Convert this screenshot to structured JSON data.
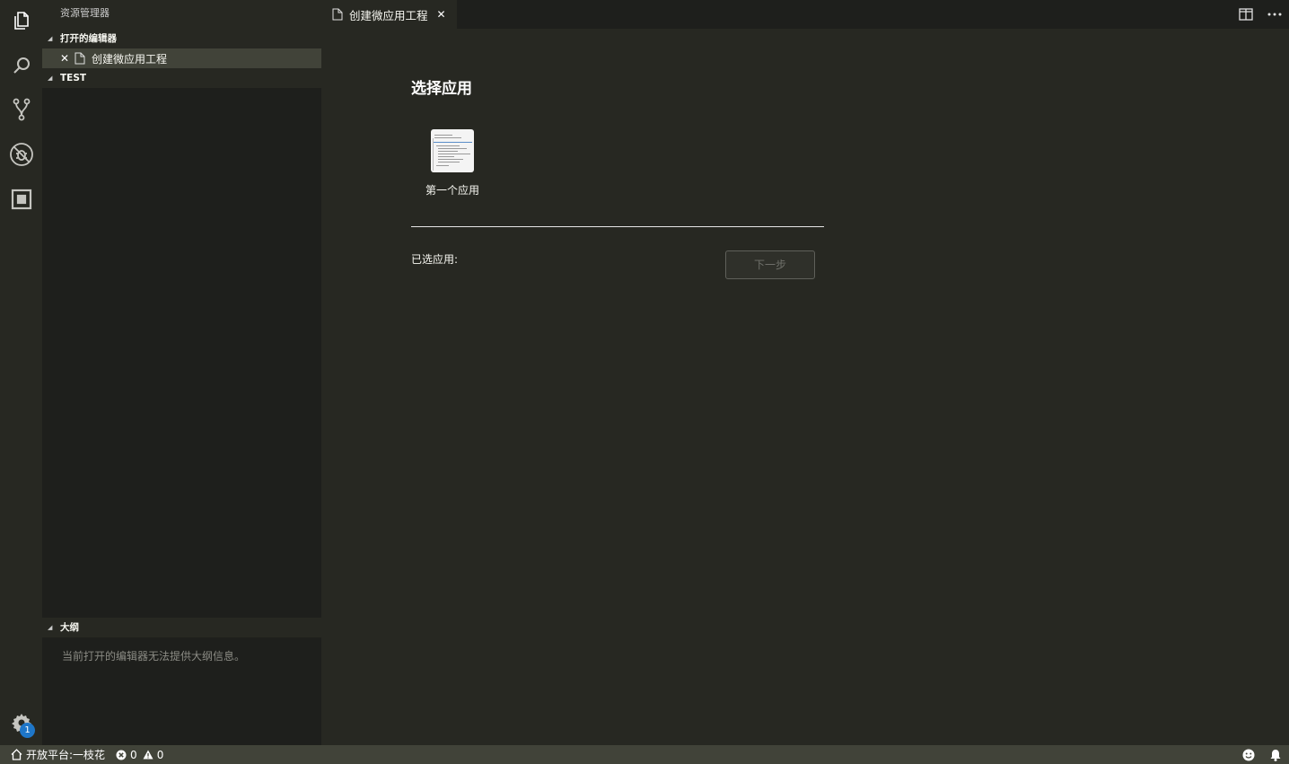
{
  "activity_bar": {
    "icons": [
      "files-icon",
      "search-icon",
      "source-control-icon",
      "debug-icon",
      "extensions-icon"
    ],
    "settings_badge": "1"
  },
  "sidebar": {
    "title": "资源管理器",
    "open_editors_header": "打开的编辑器",
    "open_editor_item": "创建微应用工程",
    "workspace_header": "TEST",
    "outline_header": "大纲",
    "outline_message": "当前打开的编辑器无法提供大纲信息。"
  },
  "tab": {
    "label": "创建微应用工程",
    "close": "✕"
  },
  "editor": {
    "title": "选择应用",
    "apps": [
      {
        "label": "第一个应用"
      }
    ],
    "selected_label": "已选应用:",
    "next_button": "下一步"
  },
  "status_bar": {
    "platform": "开放平台:一枝花",
    "errors": "0",
    "warnings": "0"
  },
  "colors": {
    "background": "#272822",
    "sidebar": "#1e1f1c",
    "selection": "#414339",
    "badge": "#1e76c8"
  }
}
